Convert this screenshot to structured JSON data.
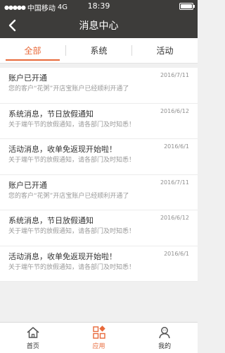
{
  "status_bar": {
    "carrier": "中国移动",
    "network": "4G",
    "time": "18:39"
  },
  "header": {
    "title": "消息中心"
  },
  "tabs": [
    {
      "label": "全部",
      "active": true
    },
    {
      "label": "系统",
      "active": false
    },
    {
      "label": "活动",
      "active": false
    }
  ],
  "messages": [
    {
      "title": "账户已开通",
      "date": "2016/7/11",
      "desc": "您的客户“花粥”开店宝账户已经顺利开通了"
    },
    {
      "title": "系统消息，节日放假通知",
      "date": "2016/6/12",
      "desc": "关于端午节的放假通知，请各部门及时知悉！"
    },
    {
      "title": "活动消息，收单免返现开始啦！",
      "date": "2016/6/1",
      "desc": "关于端午节的放假通知，请各部门及时知悉！"
    },
    {
      "title": "账户已开通",
      "date": "2016/7/11",
      "desc": "您的客户“花粥”开店宝账户已经顺利开通了"
    },
    {
      "title": "系统消息，节日放假通知",
      "date": "2016/6/12",
      "desc": "关于端午节的放假通知，请各部门及时知悉！"
    },
    {
      "title": "活动消息，收单免返现开始啦！",
      "date": "2016/6/1",
      "desc": "关于端午节的放假通知，请各部门及时知悉！"
    }
  ],
  "tabbar": [
    {
      "label": "首页",
      "icon": "home-icon",
      "active": false
    },
    {
      "label": "应用",
      "icon": "apps-icon",
      "active": true
    },
    {
      "label": "我的",
      "icon": "user-icon",
      "active": false
    }
  ],
  "colors": {
    "header_bg": "#3d3c3a",
    "accent": "#e8693a"
  }
}
